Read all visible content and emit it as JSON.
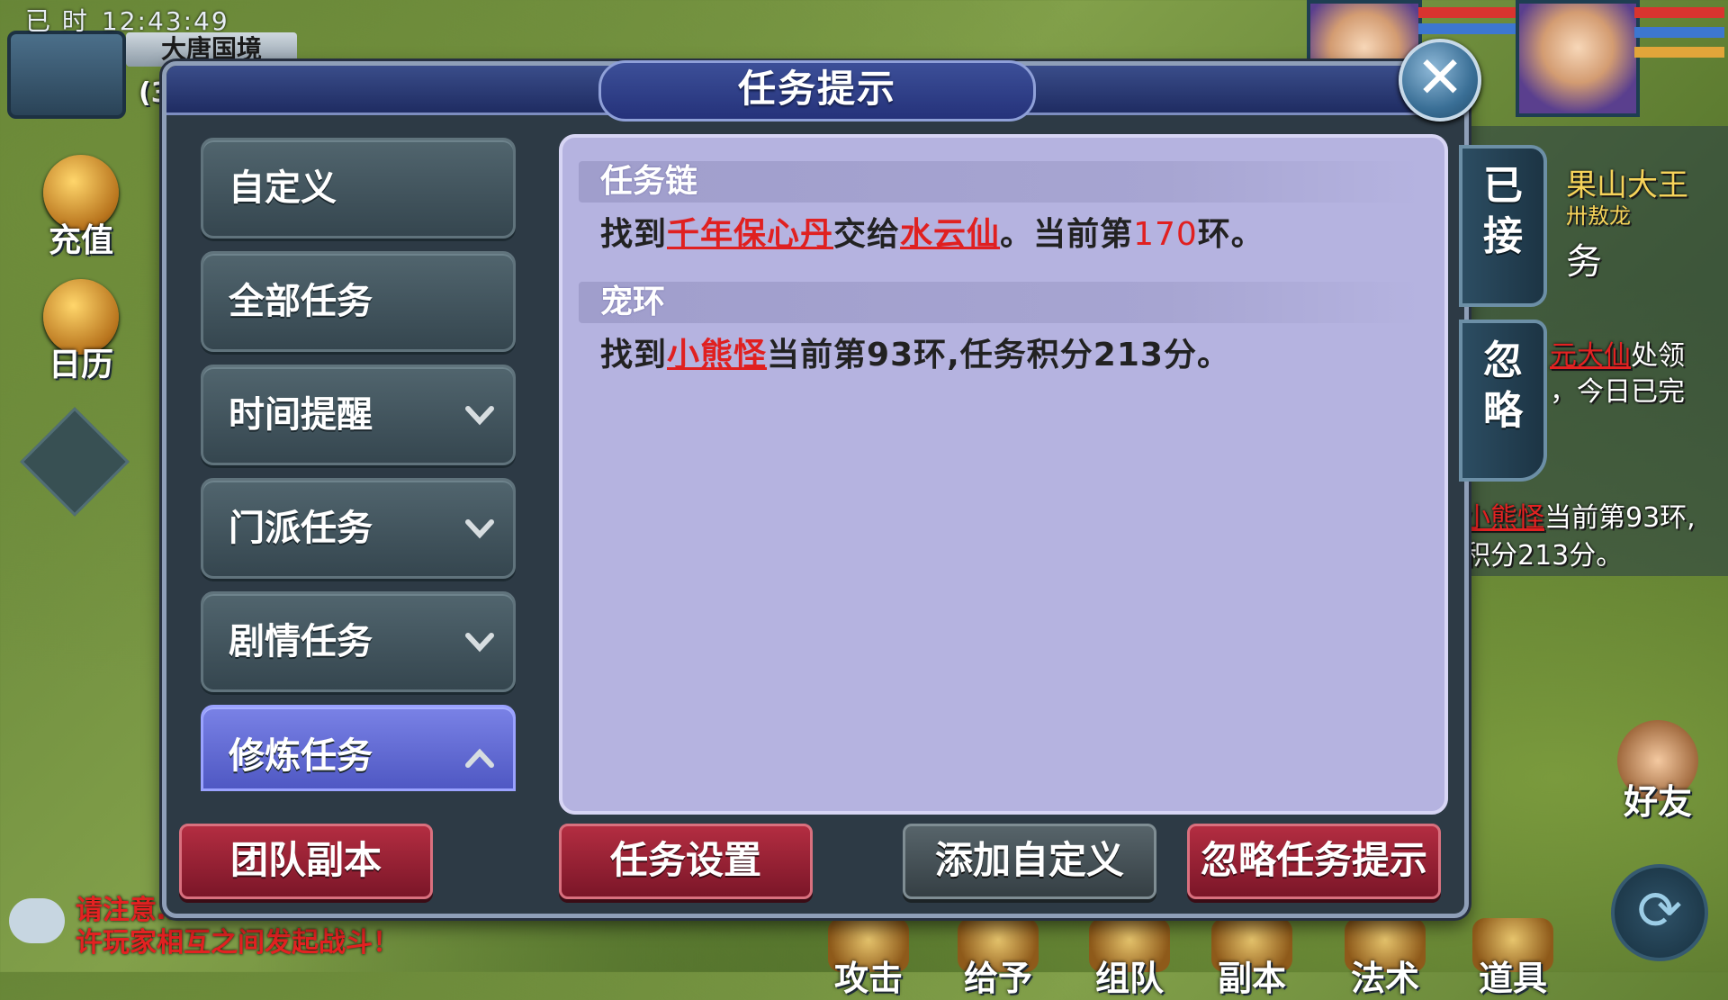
{
  "status": {
    "day": "已 时",
    "time": "12:43:49",
    "location": "大唐国境",
    "coords_partial": "(3"
  },
  "left_hud": {
    "recharge": "充值",
    "calendar": "日历"
  },
  "right_hud": {
    "bg_name": "果山大王",
    "bg_sub": "卅敖龙",
    "bg_partial": "务",
    "line1_red": "元大仙",
    "line1_rest": "处领",
    "line2": "，今日已完",
    "line3_red": "小熊怪",
    "line3_rest": "当前第93环,",
    "line4": "积分213分。"
  },
  "chat": {
    "line1": "请注意…",
    "line2": "许玩家相互之间发起战斗！"
  },
  "bottom_bar": [
    "攻击",
    "给予",
    "组队",
    "副本",
    "法术",
    "道具"
  ],
  "friend_label": "好友",
  "dialog": {
    "title": "任务提示",
    "close_symbol": "✕",
    "categories": [
      {
        "label": "自定义",
        "expandable": false,
        "active": false
      },
      {
        "label": "全部任务",
        "expandable": false,
        "active": false
      },
      {
        "label": "时间提醒",
        "expandable": true,
        "active": false
      },
      {
        "label": "门派任务",
        "expandable": true,
        "active": false
      },
      {
        "label": "剧情任务",
        "expandable": true,
        "active": false
      },
      {
        "label": "修炼任务",
        "expandable": true,
        "active": true
      }
    ],
    "tasks": [
      {
        "title": "任务链",
        "t1": "找到",
        "item": "千年保心丹",
        "t2": "交给",
        "npc": "水云仙",
        "t3": "。当前第",
        "round": "170",
        "t4": "环。"
      },
      {
        "title": "宠环",
        "t1": "找到",
        "npc": "小熊怪",
        "t2": "当前第93环,任务积分213分。"
      }
    ],
    "side_tabs": {
      "accepted": "已接",
      "ignored": "忽略"
    },
    "buttons": {
      "team_dungeon": "团队副本",
      "task_settings": "任务设置",
      "add_custom": "添加自定义",
      "ignore_hint": "忽略任务提示"
    }
  }
}
